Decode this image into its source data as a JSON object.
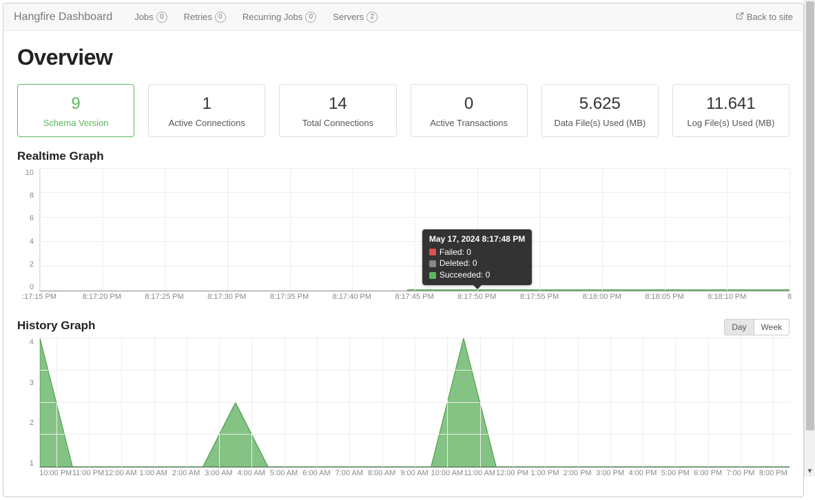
{
  "navbar": {
    "brand": "Hangfire Dashboard",
    "items": [
      {
        "label": "Jobs",
        "count": "0"
      },
      {
        "label": "Retries",
        "count": "0"
      },
      {
        "label": "Recurring Jobs",
        "count": "0"
      },
      {
        "label": "Servers",
        "count": "2"
      }
    ],
    "back_label": "Back to site"
  },
  "page": {
    "title": "Overview"
  },
  "metrics": [
    {
      "value": "9",
      "label": "Schema Version",
      "green": true
    },
    {
      "value": "1",
      "label": "Active Connections"
    },
    {
      "value": "14",
      "label": "Total Connections"
    },
    {
      "value": "0",
      "label": "Active Transactions"
    },
    {
      "value": "5.625",
      "label": "Data File(s) Used (MB)"
    },
    {
      "value": "11.641",
      "label": "Log File(s) Used (MB)"
    }
  ],
  "sections": {
    "realtime": "Realtime Graph",
    "history": "History Graph"
  },
  "tooltip": {
    "title": "May 17, 2024 8:17:48 PM",
    "rows": [
      {
        "label": "Failed: 0",
        "color": "#d9534f"
      },
      {
        "label": "Deleted: 0",
        "color": "#888"
      },
      {
        "label": "Succeeded: 0",
        "color": "#5cb85c"
      }
    ]
  },
  "toggle": {
    "day": "Day",
    "week": "Week",
    "active": "Day"
  },
  "chart_data": [
    {
      "type": "line",
      "title": "Realtime Graph",
      "ylim": [
        0,
        10
      ],
      "yticks": [
        0,
        2,
        4,
        6,
        8,
        10
      ],
      "xticks": [
        ":17:15 PM",
        "8:17:20 PM",
        "8:17:25 PM",
        "8:17:30 PM",
        "8:17:35 PM",
        "8:17:40 PM",
        "8:17:45 PM",
        "8:17:50 PM",
        "8:17:55 PM",
        "8:18:00 PM",
        "8:18:05 PM",
        "8:18:10 PM",
        "8"
      ],
      "series": [
        {
          "name": "Failed",
          "color": "#d9534f",
          "values": [
            0,
            0,
            0,
            0,
            0,
            0,
            0,
            0,
            0,
            0,
            0,
            0
          ]
        },
        {
          "name": "Deleted",
          "color": "#888",
          "values": [
            0,
            0,
            0,
            0,
            0,
            0,
            0,
            0,
            0,
            0,
            0,
            0
          ]
        },
        {
          "name": "Succeeded",
          "color": "#5cb85c",
          "values": [
            0,
            0,
            0,
            0,
            0,
            0,
            0,
            0,
            0,
            0,
            0,
            0
          ]
        }
      ]
    },
    {
      "type": "area",
      "title": "History Graph",
      "ylim": [
        0,
        4
      ],
      "yticks": [
        1,
        2,
        3,
        4
      ],
      "xticks": [
        "10:00 PM",
        "11:00 PM",
        "12:00 AM",
        "1:00 AM",
        "2:00 AM",
        "3:00 AM",
        "4:00 AM",
        "5:00 AM",
        "6:00 AM",
        "7:00 AM",
        "8:00 AM",
        "9:00 AM",
        "10:00 AM",
        "11:00 AM",
        "12:00 PM",
        "1:00 PM",
        "2:00 PM",
        "3:00 PM",
        "4:00 PM",
        "5:00 PM",
        "6:00 PM",
        "7:00 PM",
        "8:00 PM"
      ],
      "series": [
        {
          "name": "Succeeded",
          "color": "#6fb96f",
          "values": [
            4,
            0,
            0,
            0,
            0,
            0,
            2,
            0,
            0,
            0,
            0,
            0,
            0,
            4,
            0,
            0,
            0,
            0,
            0,
            0,
            0,
            0,
            0,
            0
          ]
        }
      ]
    }
  ]
}
